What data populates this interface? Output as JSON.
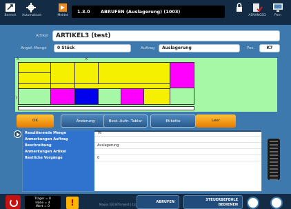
{
  "toolbar": {
    "items": [
      {
        "label": "Bereich",
        "icon": "resize-icon"
      },
      {
        "label": "Automatisch",
        "icon": "gear-icon"
      },
      {
        "label": "Meldet",
        "icon": "orange-box-icon"
      }
    ],
    "right_items": [
      {
        "label": "",
        "icon": "lock-icon"
      },
      {
        "label": "ADVANCED",
        "icon": "user-check-icon"
      },
      {
        "label": "Porn",
        "icon": "monitor-icon"
      }
    ]
  },
  "title": {
    "version": "1.3.0",
    "text": "ABRUFEN (Auslagerung) (1003)"
  },
  "form": {
    "artikel_label": "Artikel",
    "artikel_value": "ARTIKEL3 (test)",
    "menge_label": "Angef. Menge",
    "menge_value": "0 Stück",
    "auftrag_label": "Auftrag",
    "auftrag_value": "Auslagerung",
    "pos_label": "Pos.",
    "pos_value": "K7"
  },
  "grid": {
    "col_mark_a": "A",
    "col_mark_k": "K",
    "row_mark_7": "7"
  },
  "actions": {
    "ok": "OK",
    "aenderung": "Änderung",
    "best_aufn": "Best.-Aufn. Tablar",
    "etikette": "Etikette",
    "leer": "Leer"
  },
  "info": {
    "rows": [
      {
        "key": "Resultierende Menge",
        "value": "76"
      },
      {
        "key": "Anmerkungen Auftrag",
        "value": ""
      },
      {
        "key": "Beschreibung",
        "value": "Auslagerung"
      },
      {
        "key": "Anmerkungen Artikel",
        "value": ""
      },
      {
        "key": "Restliche Vorgänge",
        "value": "0"
      }
    ]
  },
  "bottom": {
    "traeger_line1": "Träger = 0",
    "traeger_line2": "Höhe = 4",
    "traeger_line3": "Wert = 0",
    "status_text": "Mouse 330 873 meint | 13.07 | 10 | 10 Lin",
    "abrufen_label": "ABRUFEN",
    "steuer_label_1": "STEUERBEFEHLE",
    "steuer_label_2": "BEDIENEN"
  },
  "colors": {
    "yellow": "#f5f000",
    "magenta": "#ff00ff",
    "blue": "#0000ee",
    "green": "#a6f7a6",
    "accent": "#2f73cf"
  }
}
